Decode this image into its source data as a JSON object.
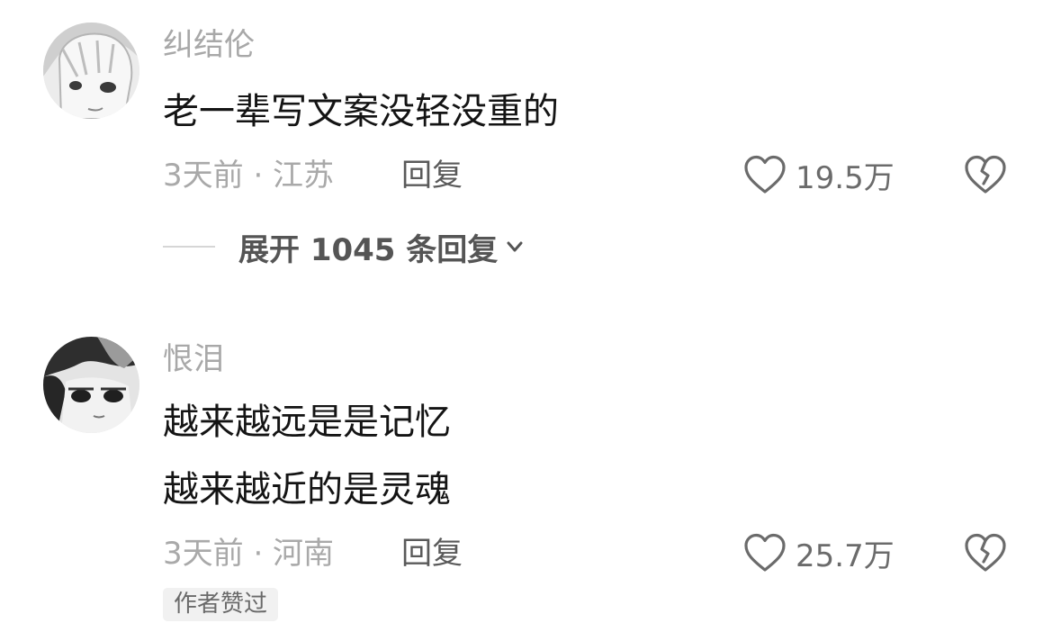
{
  "comments": [
    {
      "username": "纠结伦",
      "lines": [
        "老一辈写文案没轻没重的"
      ],
      "meta": "3天前 · 江苏",
      "reply_label": "回复",
      "likes": "19.5万",
      "expand_replies": "展开 1045 条回复",
      "avatar_icon": "anime-girl-avatar-icon"
    },
    {
      "username": "恨泪",
      "lines": [
        "越来越远是是记忆",
        "越来越近的是灵魂"
      ],
      "meta": "3天前 · 河南",
      "reply_label": "回复",
      "likes": "25.7万",
      "badge": "作者赞过",
      "avatar_icon": "anime-boy-avatar-icon"
    }
  ],
  "colors": {
    "text_primary": "#141414",
    "text_secondary": "#a8a8a8",
    "badge_bg": "#f1f1f1"
  }
}
